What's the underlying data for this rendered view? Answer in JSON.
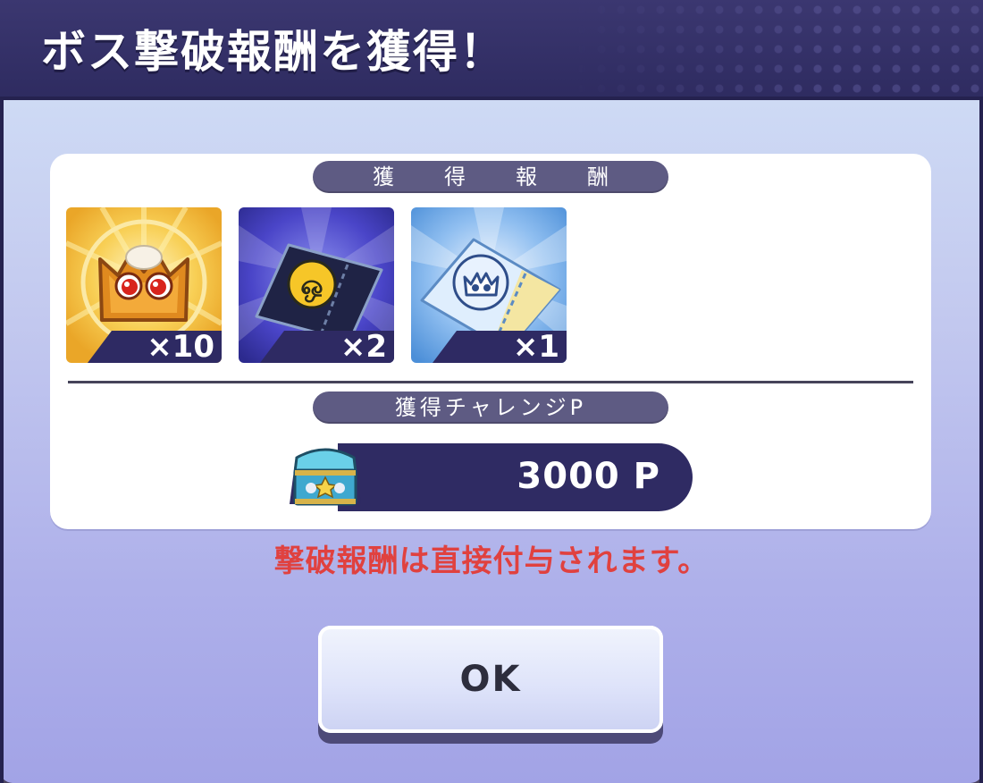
{
  "dialog": {
    "title": "ボス撃破報酬を獲得！",
    "rewards_label": "獲　得　報　酬",
    "rewards": [
      {
        "icon": "gold-crown-puyo-icon",
        "quantity": "×10"
      },
      {
        "icon": "puyo-coin-ticket-icon",
        "quantity": "×2"
      },
      {
        "icon": "crown-ticket-icon",
        "quantity": "×1"
      }
    ],
    "challenge_label": "獲得チャレンジP",
    "points": {
      "icon": "treasure-chest-icon",
      "value": "3000 P"
    },
    "notice": "撃破報酬は直接付与されます。",
    "ok_label": "OK"
  },
  "colors": {
    "header_bg": "#2e2b60",
    "panel_bg": "#ffffff",
    "pill_bg": "#5e5b83",
    "notice_text": "#e0413f",
    "points_bar": "#2f2b63"
  }
}
